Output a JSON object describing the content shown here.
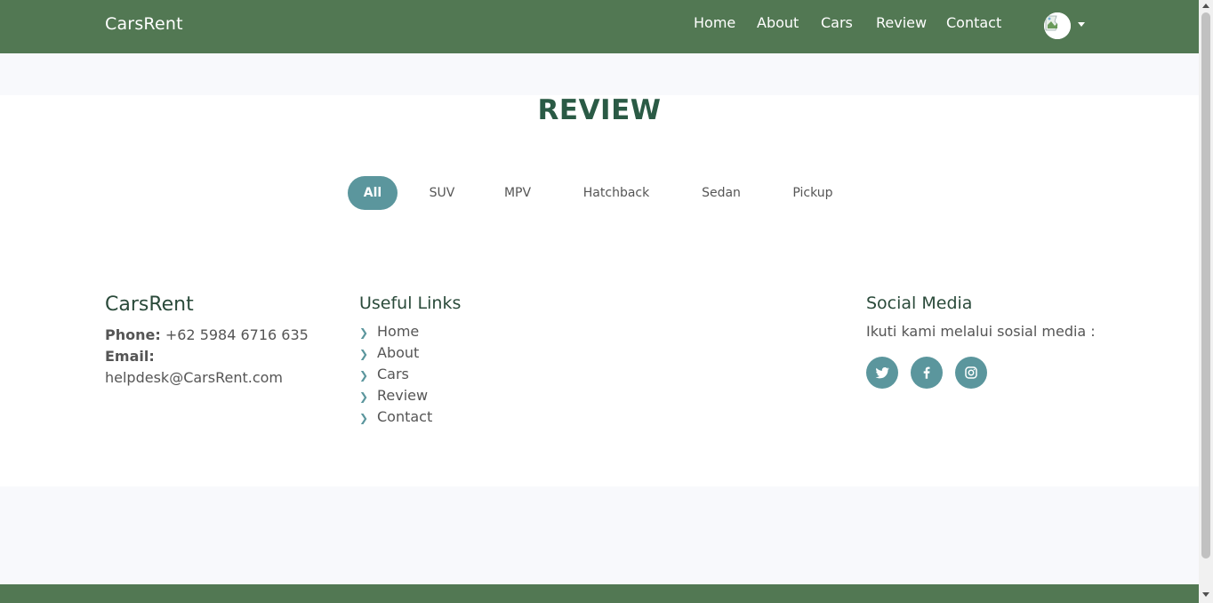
{
  "header": {
    "brand": "CarsRent",
    "nav": [
      "Home",
      "About",
      "Cars",
      "Review",
      "Contact"
    ]
  },
  "main": {
    "title": "REVIEW",
    "filters": [
      "All",
      "SUV",
      "MPV",
      "Hatchback",
      "Sedan",
      "Pickup"
    ],
    "active_filter": "All"
  },
  "footer": {
    "brand": "CarsRent",
    "phone_label": "Phone:",
    "phone": "+62 5984 6716 635",
    "email_label": "Email:",
    "email": "helpdesk@CarsRent.com",
    "links_title": "Useful Links",
    "links": [
      "Home",
      "About",
      "Cars",
      "Review",
      "Contact"
    ],
    "social_title": "Social Media",
    "social_text": "Ikuti kami melalui sosial media :",
    "social_icons": [
      "twitter-icon",
      "facebook-icon",
      "instagram-icon"
    ]
  },
  "colors": {
    "header_bg": "#527853",
    "accent": "#5b969d",
    "title": "#2a5a45"
  }
}
